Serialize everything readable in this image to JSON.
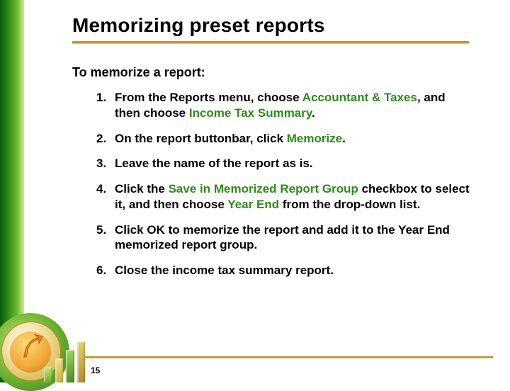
{
  "title": "Memorizing preset reports",
  "lead": "To memorize a report:",
  "steps": [
    {
      "pre": "From the Reports menu, choose ",
      "kw1": "Accountant & Taxes",
      "mid": ", and then choose ",
      "kw2": "Income Tax Summary",
      "post": "."
    },
    {
      "pre": "On the report buttonbar, click ",
      "kw1": "Memorize",
      "mid": "",
      "kw2": "",
      "post": "."
    },
    {
      "pre": "Leave the name of the report as is.",
      "kw1": "",
      "mid": "",
      "kw2": "",
      "post": ""
    },
    {
      "pre": "Click the ",
      "kw1": "Save in Memorized Report Group",
      "mid": " checkbox to select it, and then choose ",
      "kw2": "Year End",
      "post": " from the drop-down list."
    },
    {
      "pre": "Click OK to memorize the report and add it to the Year End memorized report group.",
      "kw1": "",
      "mid": "",
      "kw2": "",
      "post": ""
    },
    {
      "pre": "Close the income tax summary report.",
      "kw1": "",
      "mid": "",
      "kw2": "",
      "post": ""
    }
  ],
  "page_number": "15"
}
